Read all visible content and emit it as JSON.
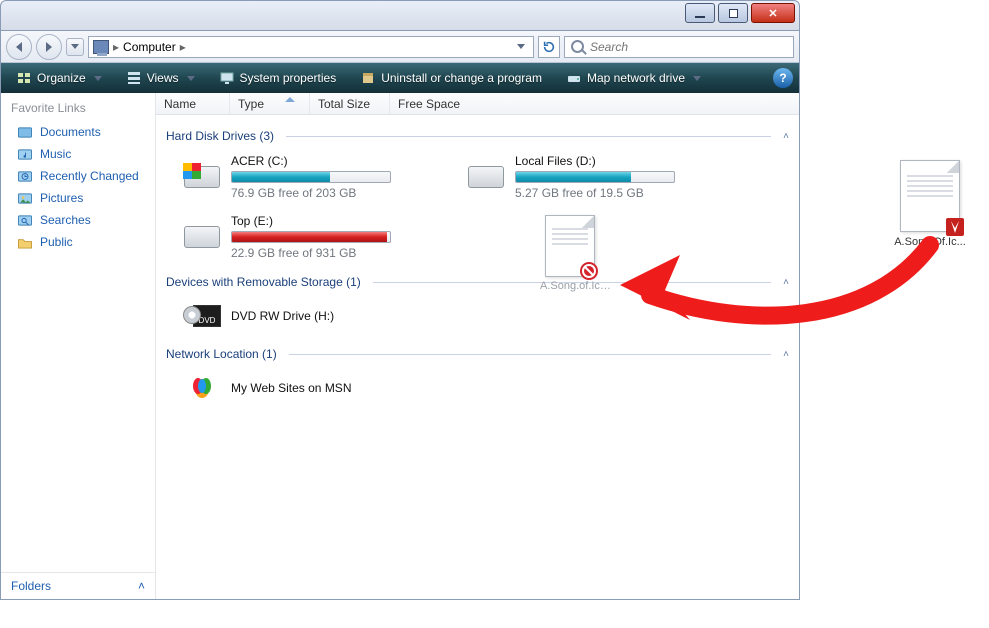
{
  "titlebar": {
    "min": "minimize",
    "max": "maximize",
    "close": "close"
  },
  "nav": {
    "location": "Computer",
    "arrow": "▸",
    "search_placeholder": "Search"
  },
  "cmdbar": {
    "organize": "Organize",
    "views": "Views",
    "sysprops": "System properties",
    "uninstall": "Uninstall or change a program",
    "mapdrive": "Map network drive"
  },
  "sidebar": {
    "header": "Favorite Links",
    "links": [
      {
        "label": "Documents",
        "icon": "documents"
      },
      {
        "label": "Music",
        "icon": "music"
      },
      {
        "label": "Recently Changed",
        "icon": "recent"
      },
      {
        "label": "Pictures",
        "icon": "pictures"
      },
      {
        "label": "Searches",
        "icon": "searches"
      },
      {
        "label": "Public",
        "icon": "public"
      }
    ],
    "folders": "Folders"
  },
  "columns": {
    "name": "Name",
    "type": "Type",
    "total": "Total Size",
    "free": "Free Space"
  },
  "groups": {
    "hdd": {
      "title": "Hard Disk Drives (3)"
    },
    "removable": {
      "title": "Devices with Removable Storage (1)"
    },
    "network": {
      "title": "Network Location (1)"
    }
  },
  "drives": {
    "acer": {
      "name": "ACER (C:)",
      "free_text": "76.9 GB free of 203 GB",
      "percent_used": 62,
      "color": "teal"
    },
    "local": {
      "name": "Local Files (D:)",
      "free_text": "5.27 GB free of 19.5 GB",
      "percent_used": 73,
      "color": "teal"
    },
    "top": {
      "name": "Top (E:)",
      "free_text": "22.9 GB free of 931 GB",
      "percent_used": 98,
      "color": "red"
    },
    "dvd": {
      "name": "DVD RW Drive (H:)"
    },
    "msn": {
      "name": "My Web Sites on MSN"
    }
  },
  "dragfile": {
    "label": "A.Song.of.Ic…"
  },
  "desktopfile": {
    "label": "A.Song.Of.Ic..."
  }
}
